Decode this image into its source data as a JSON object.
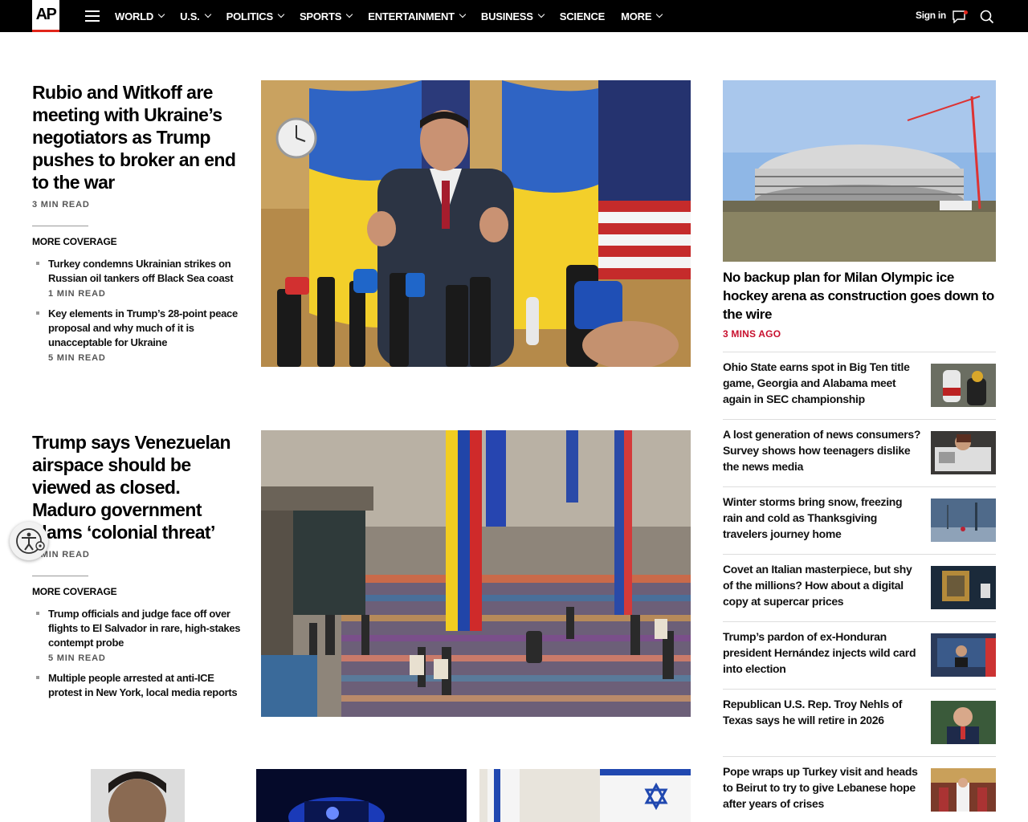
{
  "header": {
    "logo": "AP",
    "nav": [
      "WORLD",
      "U.S.",
      "POLITICS",
      "SPORTS",
      "ENTERTAINMENT",
      "BUSINESS",
      "SCIENCE",
      "MORE"
    ],
    "nav_has_dropdown": [
      true,
      true,
      true,
      true,
      true,
      true,
      false,
      true
    ],
    "sign_in": "Sign in"
  },
  "lead1": {
    "headline": "Rubio and Witkoff are meeting with Ukraine’s negotiators as Trump pushes to broker an end to the war",
    "read_time": "3 MIN READ",
    "more_coverage": "MORE COVERAGE",
    "items": [
      {
        "title": "Turkey condemns Ukrainian strikes on Russian oil tankers off Black Sea coast",
        "meta": "1 MIN READ"
      },
      {
        "title": "Key elements in Trump’s 28-point peace proposal and why much of it is unacceptable for Ukraine",
        "meta": "5 MIN READ"
      }
    ]
  },
  "lead2": {
    "headline": "Trump says Venezuelan airspace should be viewed as closed. Maduro government slams ‘colonial threat’",
    "read_time": "3 MIN READ",
    "more_coverage": "MORE COVERAGE",
    "items": [
      {
        "title": "Trump officials and judge face off over flights to El Salvador in rare, high-stakes contempt probe",
        "meta": "5 MIN READ"
      },
      {
        "title": "Multiple people arrested at anti-ICE protest in New York, local media reports",
        "meta": ""
      }
    ]
  },
  "right": {
    "lead_title": "No backup plan for Milan Olympic ice hockey arena as construction goes down to the wire",
    "lead_time": "3 MINS AGO",
    "items": [
      {
        "title": "Ohio State earns spot in Big Ten title game, Georgia and Alabama meet again in SEC championship"
      },
      {
        "title": "A lost generation of news consumers? Survey shows how teenagers dislike the news media"
      },
      {
        "title": "Winter storms bring snow, freezing rain and cold as Thanksgiving travelers journey home"
      },
      {
        "title": "Covet an Italian masterpiece, but shy of the millions? How about a digital copy at supercar prices"
      },
      {
        "title": "Trump’s pardon of ex-Honduran president Hernández injects wild card into election"
      },
      {
        "title": "Republican U.S. Rep. Troy Nehls of Texas says he will retire in 2026"
      },
      {
        "title": "Pope wraps up Turkey visit and heads to Beirut to try to give Lebanese hope after years of crises"
      }
    ]
  },
  "colors": {
    "accent_red": "#c8102e",
    "logo_red": "#e1251b",
    "nav_bg": "#000000"
  }
}
